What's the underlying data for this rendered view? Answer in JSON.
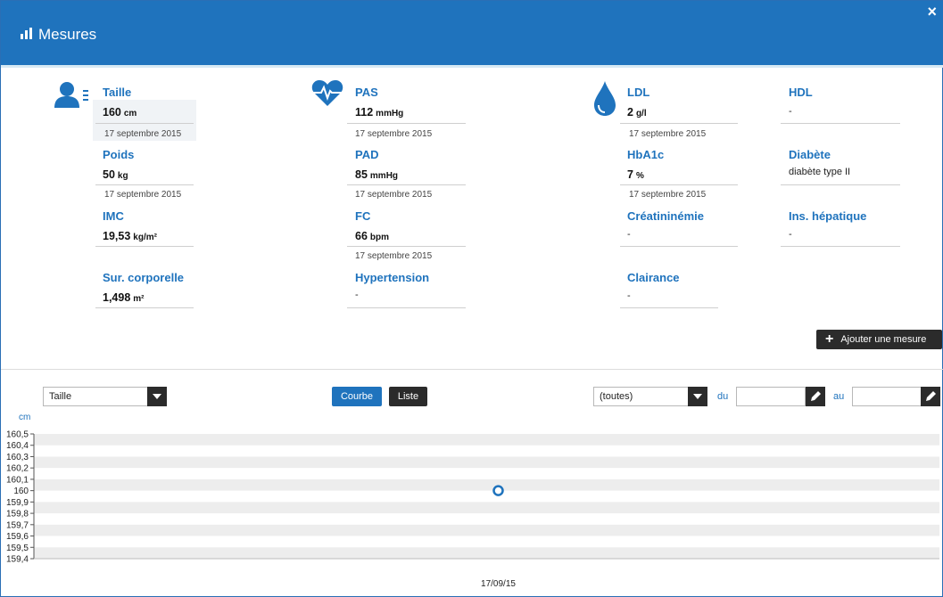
{
  "window": {
    "title": "Mesures",
    "close_label": "×",
    "bar_icon": "bar-chart-icon",
    "close_icon": "close-icon"
  },
  "colors": {
    "accent": "#1f73bd",
    "dark": "#2b2b2b"
  },
  "measures": {
    "icons": [
      "person-list-icon",
      "heartbeat-icon",
      "drop-icon"
    ],
    "taille": {
      "label": "Taille",
      "value": "160",
      "unit": "cm",
      "date": "17 septembre 2015"
    },
    "poids": {
      "label": "Poids",
      "value": "50",
      "unit": "kg",
      "date": "17 septembre 2015"
    },
    "imc": {
      "label": "IMC",
      "value": "19,53",
      "unit": "kg/m²"
    },
    "surface": {
      "label": "Sur. corporelle",
      "value": "1,498",
      "unit": "m²"
    },
    "pas": {
      "label": "PAS",
      "value": "112",
      "unit": "mmHg",
      "date": "17 septembre 2015"
    },
    "pad": {
      "label": "PAD",
      "value": "85",
      "unit": "mmHg",
      "date": "17 septembre 2015"
    },
    "fc": {
      "label": "FC",
      "value": "66",
      "unit": "bpm",
      "date": "17 septembre 2015"
    },
    "hypertension": {
      "label": "Hypertension",
      "value": "-"
    },
    "ldl": {
      "label": "LDL",
      "value": "2",
      "unit": "g/l",
      "date": "17 septembre 2015"
    },
    "hba1c": {
      "label": "HbA1c",
      "value": "7",
      "unit": "%",
      "date": "17 septembre 2015"
    },
    "creatininemie": {
      "label": "Créatininémie",
      "value": "-"
    },
    "clairance": {
      "label": "Clairance",
      "value": "-"
    },
    "hdl": {
      "label": "HDL",
      "value": "-"
    },
    "diabete": {
      "label": "Diabète",
      "value": "diabète type II"
    },
    "ins_hepatique": {
      "label": "Ins. hépatique",
      "value": "-"
    }
  },
  "add_button": {
    "label": "Ajouter une mesure",
    "icon": "plus-icon"
  },
  "controls": {
    "measure_select": "Taille",
    "mode_courbe": "Courbe",
    "mode_liste": "Liste",
    "period_select": "(toutes)",
    "from_label": "du",
    "to_label": "au",
    "from_value": "",
    "to_value": "",
    "pencil_icon": "pencil-icon"
  },
  "chart_data": {
    "type": "scatter",
    "ylabel": "cm",
    "ylim": [
      159.4,
      160.5
    ],
    "yticks": [
      "160,5",
      "160,4",
      "160,3",
      "160,2",
      "160,1",
      "160",
      "159,9",
      "159,8",
      "159,7",
      "159,6",
      "159,5",
      "159,4"
    ],
    "x": [
      "17/09/15"
    ],
    "values": [
      160
    ],
    "grid": true,
    "legend": "none"
  }
}
